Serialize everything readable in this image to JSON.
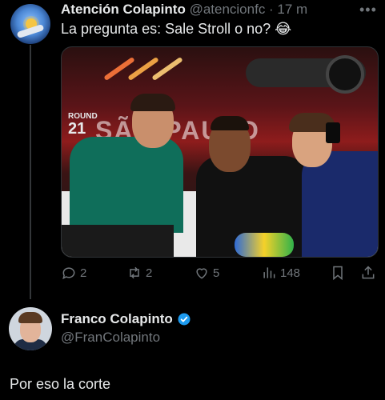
{
  "tweet": {
    "author_name": "Atención Colapinto",
    "handle_time": "@atencionfc · 17 m",
    "text": "La pregunta es: Sale Stroll o no? 😂",
    "media": {
      "round_label": "ROUND",
      "round_number": "21",
      "venue_text": "SÃO PAULO"
    },
    "actions": {
      "replies": "2",
      "retweets": "2",
      "likes": "5",
      "views": "148"
    }
  },
  "reply": {
    "author_name": "Franco Colapinto",
    "handle": "@FranColapinto",
    "text": "Por eso la corte"
  },
  "colors": {
    "background": "#000000",
    "text": "#e7e9ea",
    "muted": "#71767b",
    "verified": "#1d9bf0"
  },
  "icons": [
    "more-icon",
    "reply-icon",
    "retweet-icon",
    "like-icon",
    "views-icon",
    "bookmark-icon",
    "share-icon",
    "verified-icon"
  ]
}
